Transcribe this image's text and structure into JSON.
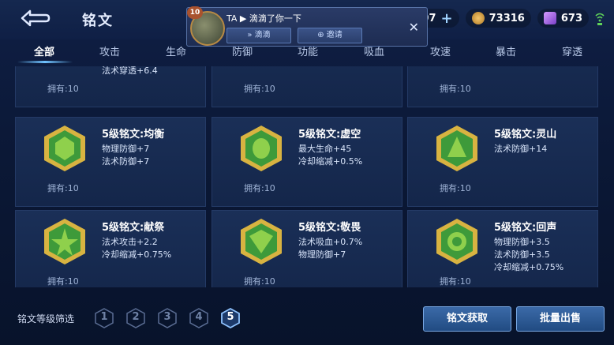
{
  "header": {
    "title": "铭文",
    "back_icon": "back-arrow-icon"
  },
  "currency": {
    "coupons": "25607",
    "gold": "73316",
    "gems": "673"
  },
  "notification": {
    "avatar_level": "10",
    "message": "TA ▶ 滴滴了你一下",
    "btn_didi": "滴滴",
    "btn_invite": "邀请"
  },
  "tabs": [
    "全部",
    "攻击",
    "生命",
    "防御",
    "功能",
    "吸血",
    "攻速",
    "暴击",
    "穿透"
  ],
  "partial_row": {
    "owned": "拥有:10",
    "partial_stat": "法术穿透+6.4"
  },
  "cards": [
    {
      "name": "5级铭文:均衡",
      "stats": [
        "物理防御+7",
        "法术防御+7"
      ],
      "owned": "拥有:10"
    },
    {
      "name": "5级铭文:虚空",
      "stats": [
        "最大生命+45",
        "冷却缩减+0.5%"
      ],
      "owned": "拥有:10"
    },
    {
      "name": "5级铭文:灵山",
      "stats": [
        "法术防御+14"
      ],
      "owned": "拥有:10"
    },
    {
      "name": "5级铭文:献祭",
      "stats": [
        "法术攻击+2.2",
        "冷却缩减+0.75%"
      ],
      "owned": "拥有:10"
    },
    {
      "name": "5级铭文:敬畏",
      "stats": [
        "法术吸血+0.7%",
        "物理防御+7"
      ],
      "owned": "拥有:10"
    },
    {
      "name": "5级铭文:回声",
      "stats": [
        "物理防御+3.5",
        "法术防御+3.5",
        "冷却缩减+0.75%"
      ],
      "owned": "拥有:10"
    }
  ],
  "footer": {
    "filter_label": "铭文等级筛选",
    "levels": [
      "1",
      "2",
      "3",
      "4",
      "5"
    ],
    "selected_level": "5",
    "get_btn": "铭文获取",
    "sell_btn": "批量出售"
  },
  "colors": {
    "gem_gold": "#d8b341",
    "gem_green": "#3e9a3a",
    "accent": "#6fc2ff"
  }
}
